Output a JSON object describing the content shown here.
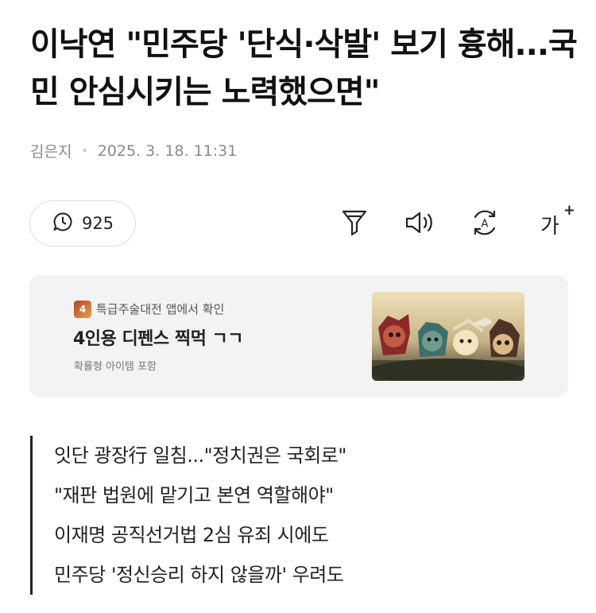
{
  "article": {
    "headline": "이낙연 \"민주당 '단식·삭발' 보기 흉해...국민 안심시키는 노력했으면\"",
    "author": "김은지",
    "separator": "•",
    "date": "2025. 3. 18. 11:31",
    "comment_count": "925"
  },
  "toolbar": {
    "icons": [
      "filter-icon",
      "speaker-icon",
      "translate-icon",
      "font-size-icon"
    ],
    "font_size_label": "가",
    "font_size_plus": "+"
  },
  "ad": {
    "app_icon_text": "4",
    "source": "특급주술대전 앱에서 확인",
    "title": "4인용 디펜스 찍먹 ㄱㄱ",
    "subtitle": "확률형 아이템 포함"
  },
  "summary": {
    "lines": [
      "잇단 광장行 일침...\"정치권은 국회로\"",
      "\"재판 법원에 맡기고 본연 역할해야\"",
      "이재명 공직선거법 2심 유죄 시에도",
      "민주당 '정신승리 하지 않을까' 우려도"
    ]
  }
}
